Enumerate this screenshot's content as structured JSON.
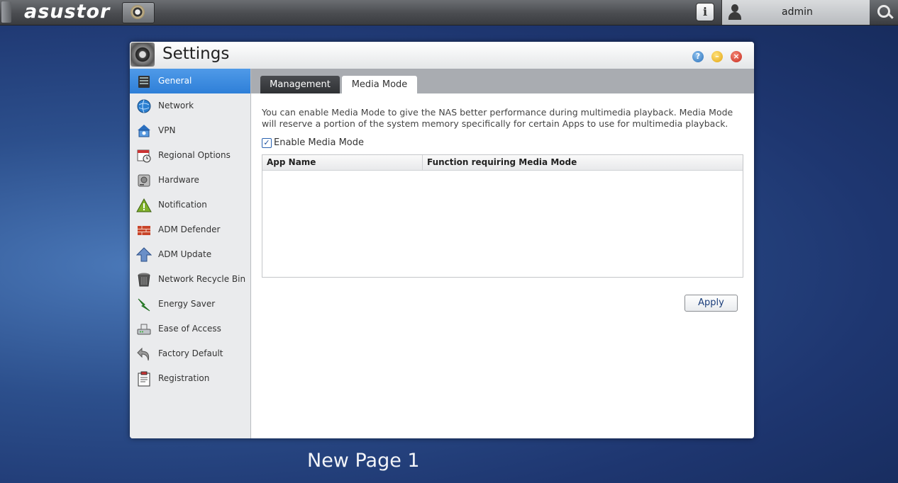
{
  "topbar": {
    "logo": "asustor",
    "user": "admin"
  },
  "window": {
    "title": "Settings",
    "help_label": "?",
    "minimize_label": "–",
    "close_label": "×"
  },
  "sidebar": {
    "items": [
      {
        "label": "General",
        "icon": "server-icon"
      },
      {
        "label": "Network",
        "icon": "globe-icon"
      },
      {
        "label": "VPN",
        "icon": "vpn-icon"
      },
      {
        "label": "Regional Options",
        "icon": "calendar-clock-icon"
      },
      {
        "label": "Hardware",
        "icon": "hard-drive-icon"
      },
      {
        "label": "Notification",
        "icon": "warning-icon"
      },
      {
        "label": "ADM Defender",
        "icon": "firewall-icon"
      },
      {
        "label": "ADM Update",
        "icon": "up-arrow-icon"
      },
      {
        "label": "Network Recycle Bin",
        "icon": "trash-icon"
      },
      {
        "label": "Energy Saver",
        "icon": "lightning-icon"
      },
      {
        "label": "Ease of Access",
        "icon": "router-icon"
      },
      {
        "label": "Factory Default",
        "icon": "undo-icon"
      },
      {
        "label": "Registration",
        "icon": "clipboard-icon"
      }
    ]
  },
  "tabs": {
    "management": "Management",
    "media_mode": "Media Mode"
  },
  "media_mode": {
    "description": "You can enable Media Mode to give the NAS better performance during multimedia playback. Media Mode will reserve a portion of the system memory specifically for certain Apps to use for multimedia playback.",
    "enable_label": "Enable Media Mode",
    "enabled": true,
    "table_headers": [
      "App Name",
      "Function requiring Media Mode"
    ],
    "rows": [],
    "apply_label": "Apply"
  },
  "desktop": {
    "page_label": "New Page 1"
  }
}
